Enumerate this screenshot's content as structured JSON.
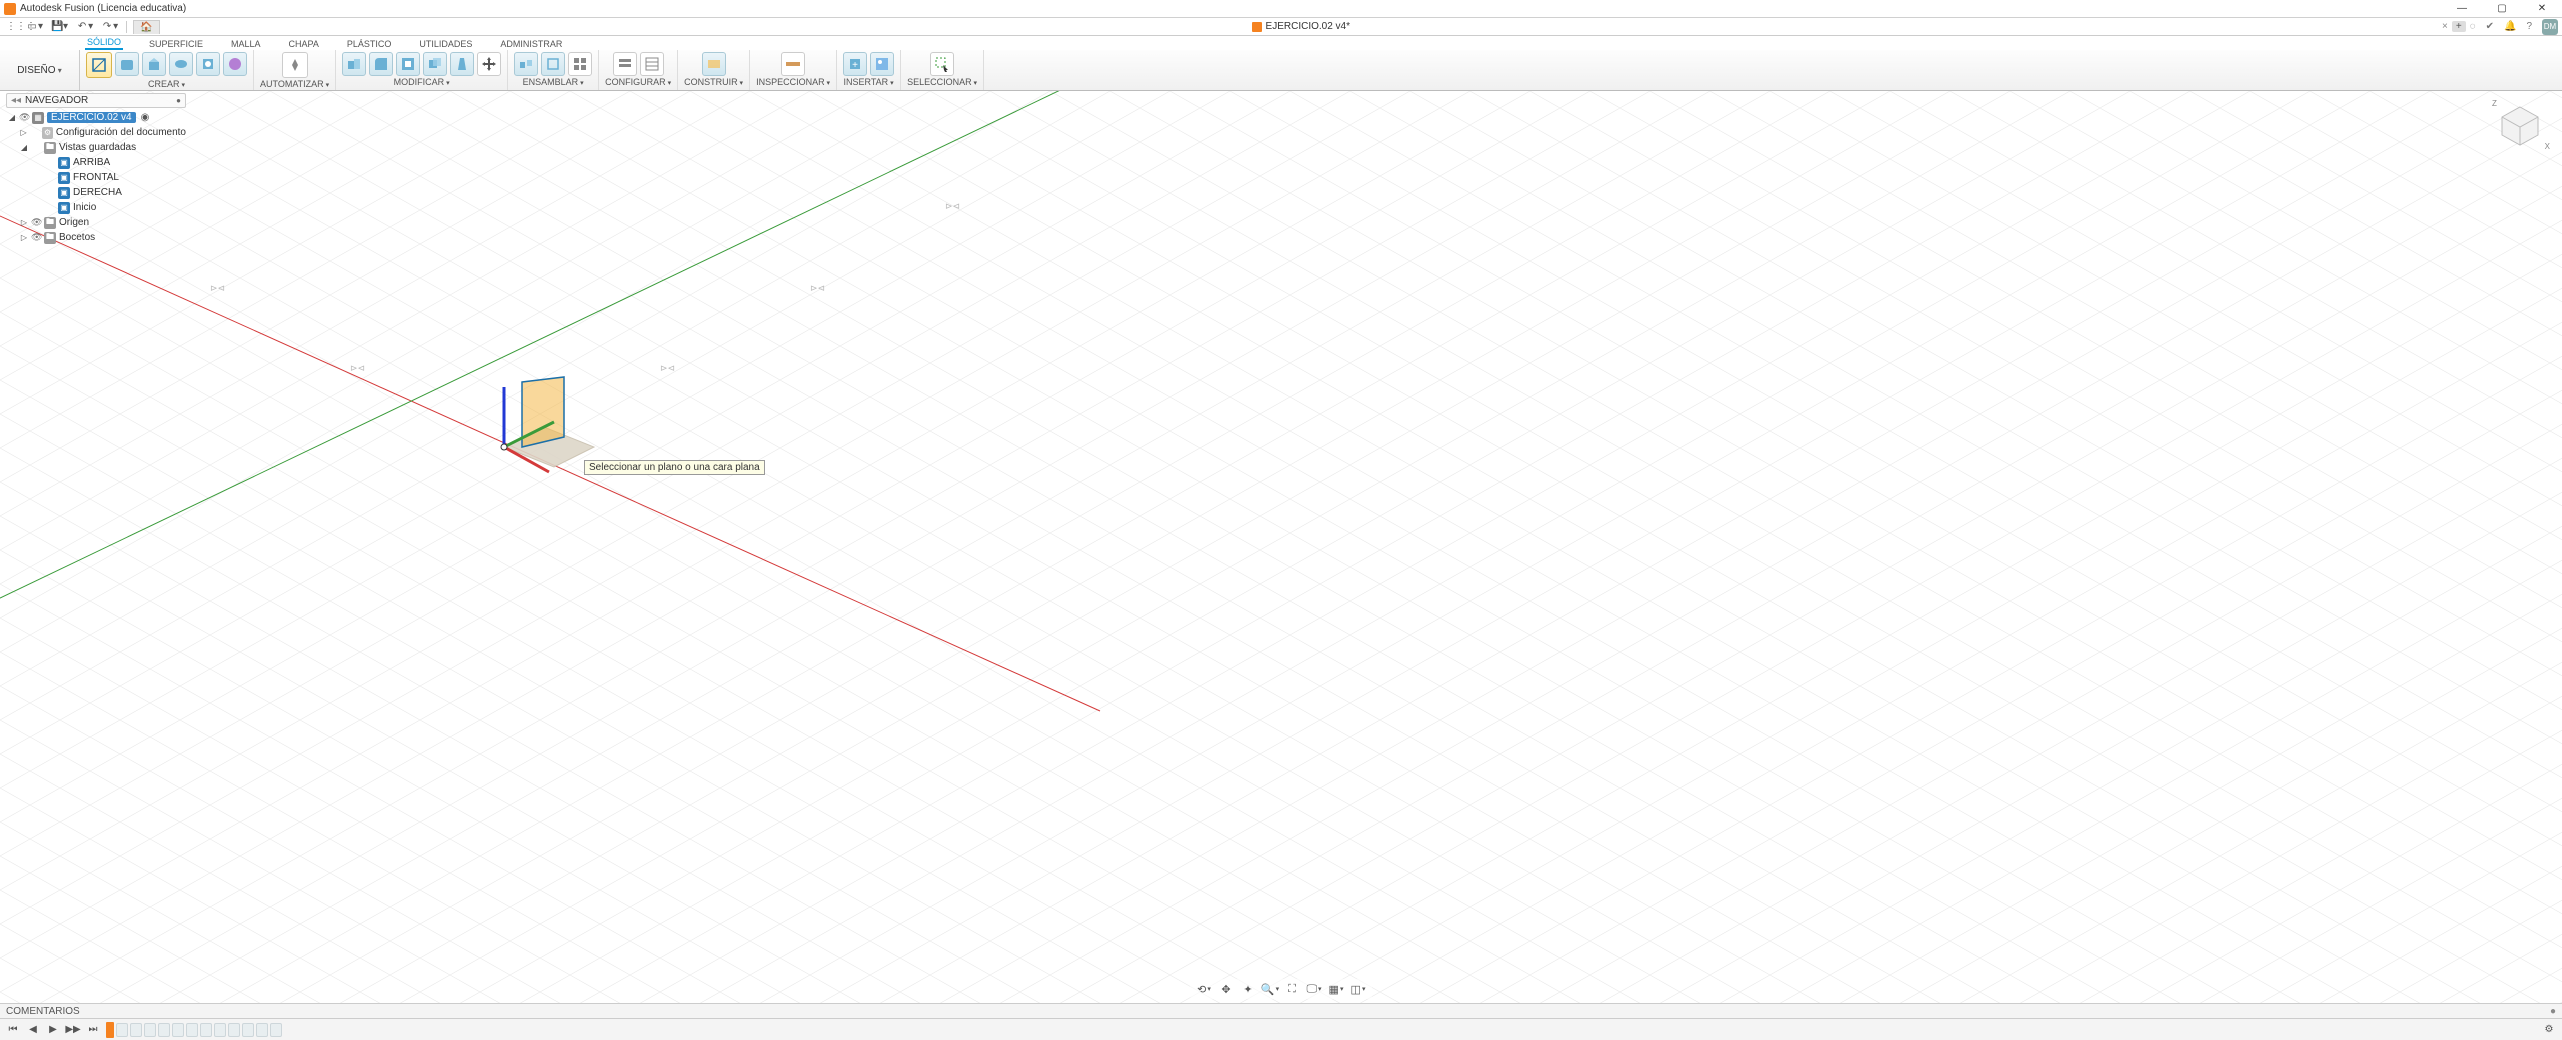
{
  "window": {
    "title": "Autodesk Fusion (Licencia educativa)",
    "doc_title": "EJERCICIO.02 v4*",
    "avatar": "DM"
  },
  "qat": {
    "tip_close": "×",
    "tip_newtab": "+"
  },
  "tabs": {
    "solido": "SÓLIDO",
    "superficie": "SUPERFICIE",
    "malla": "MALLA",
    "chapa": "CHAPA",
    "plastico": "PLÁSTICO",
    "utilidades": "UTILIDADES",
    "administrar": "ADMINISTRAR"
  },
  "workspace": {
    "label": "DISEÑO"
  },
  "panels": {
    "crear": "CREAR",
    "automatizar": "AUTOMATIZAR",
    "modificar": "MODIFICAR",
    "ensamblar": "ENSAMBLAR",
    "configurar": "CONFIGURAR",
    "construir": "CONSTRUIR",
    "inspeccionar": "INSPECCIONAR",
    "insertar": "INSERTAR",
    "seleccionar": "SELECCIONAR"
  },
  "browser": {
    "title": "NAVEGADOR",
    "root": "EJERCICIO.02 v4",
    "doc_settings": "Configuración del documento",
    "named_views": "Vistas guardadas",
    "views": {
      "top": "ARRIBA",
      "front": "FRONTAL",
      "right": "DERECHA",
      "home": "Inicio"
    },
    "origin": "Origen",
    "sketches": "Bocetos"
  },
  "viewcube": {
    "z": "Z",
    "x": "X"
  },
  "tooltip": "Seleccionar un plano o una cara plana",
  "comments": {
    "label": "COMENTARIOS"
  },
  "navbar_icons": [
    "orbit",
    "pan",
    "zoom",
    "zoom-fit",
    "look",
    "display",
    "grid",
    "viewports"
  ]
}
